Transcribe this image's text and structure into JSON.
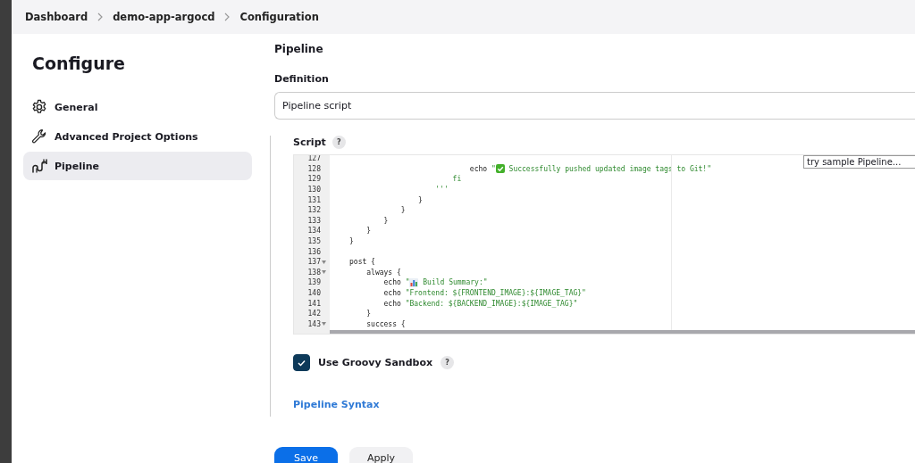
{
  "breadcrumbs": [
    {
      "label": "Dashboard"
    },
    {
      "label": "demo-app-argocd"
    },
    {
      "label": "Configuration"
    }
  ],
  "sidebar": {
    "title": "Configure",
    "items": [
      {
        "label": "General",
        "selected": false
      },
      {
        "label": "Advanced Project Options",
        "selected": false
      },
      {
        "label": "Pipeline",
        "selected": true
      }
    ]
  },
  "section_title": "Pipeline",
  "definition": {
    "label": "Definition",
    "value": "Pipeline script"
  },
  "script": {
    "label": "Script",
    "help": "?",
    "sample_select": "try sample Pipeline...",
    "lines": [
      {
        "number": "127",
        "fold": false
      },
      {
        "number": "128",
        "fold": false,
        "segments": [
          {
            "kind": "plain",
            "text": "                            echo "
          },
          {
            "kind": "string",
            "text": "\""
          },
          {
            "kind": "check-icon"
          },
          {
            "kind": "string",
            "text": " Successfully pushed updated image tags to Git!\""
          }
        ]
      },
      {
        "number": "129",
        "fold": false,
        "segments": [
          {
            "kind": "string",
            "text": "                        fi"
          }
        ]
      },
      {
        "number": "130",
        "fold": false,
        "segments": [
          {
            "kind": "string",
            "text": "                    '''"
          }
        ]
      },
      {
        "number": "131",
        "fold": false,
        "segments": [
          {
            "kind": "plain",
            "text": "                }"
          }
        ]
      },
      {
        "number": "132",
        "fold": false,
        "segments": [
          {
            "kind": "plain",
            "text": "            }"
          }
        ]
      },
      {
        "number": "133",
        "fold": false,
        "segments": [
          {
            "kind": "plain",
            "text": "        }"
          }
        ]
      },
      {
        "number": "134",
        "fold": false,
        "segments": [
          {
            "kind": "plain",
            "text": "    }"
          }
        ]
      },
      {
        "number": "135",
        "fold": false,
        "segments": [
          {
            "kind": "plain",
            "text": "}"
          }
        ]
      },
      {
        "number": "136",
        "fold": false
      },
      {
        "number": "137",
        "fold": true,
        "segments": [
          {
            "kind": "plain",
            "text": "post {"
          }
        ]
      },
      {
        "number": "138",
        "fold": true,
        "segments": [
          {
            "kind": "plain",
            "text": "    always {"
          }
        ]
      },
      {
        "number": "139",
        "fold": false,
        "segments": [
          {
            "kind": "plain",
            "text": "        echo "
          },
          {
            "kind": "string",
            "text": "\""
          },
          {
            "kind": "chart-icon"
          },
          {
            "kind": "string",
            "text": " Build Summary:\""
          }
        ]
      },
      {
        "number": "140",
        "fold": false,
        "segments": [
          {
            "kind": "plain",
            "text": "        echo "
          },
          {
            "kind": "string",
            "text": "\"Frontend: ${FRONTEND_IMAGE}:${IMAGE_TAG}\""
          }
        ]
      },
      {
        "number": "141",
        "fold": false,
        "segments": [
          {
            "kind": "plain",
            "text": "        echo "
          },
          {
            "kind": "string",
            "text": "\"Backend: ${BACKEND_IMAGE}:${IMAGE_TAG}\""
          }
        ]
      },
      {
        "number": "142",
        "fold": false,
        "segments": [
          {
            "kind": "plain",
            "text": "    }"
          }
        ]
      },
      {
        "number": "143",
        "fold": true,
        "segments": [
          {
            "kind": "plain",
            "text": "    success {"
          }
        ]
      }
    ]
  },
  "sandbox": {
    "label": "Use Groovy Sandbox",
    "checked": true,
    "help": "?"
  },
  "syntax_link": "Pipeline Syntax",
  "buttons": [
    {
      "label": "Save",
      "kind": "primary"
    },
    {
      "label": "Apply",
      "kind": "secondary"
    }
  ]
}
